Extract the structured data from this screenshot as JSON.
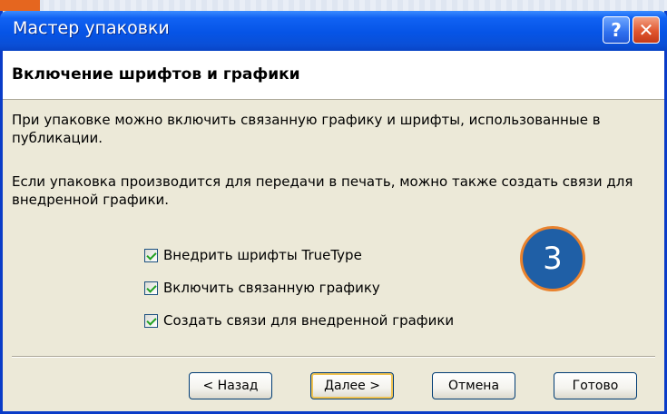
{
  "window": {
    "title": "Мастер упаковки",
    "help_glyph": "?",
    "close_glyph": "✕"
  },
  "header": {
    "title": "Включение шрифтов и графики"
  },
  "body": {
    "paragraph1": "При упаковке можно включить связанную графику и шрифты, использованные в публикации.",
    "paragraph2": "Если упаковка производится для передачи в печать, можно также создать связи для внедренной графики."
  },
  "options": [
    {
      "label": "Внедрить шрифты TrueType",
      "checked": true
    },
    {
      "label": "Включить связанную графику",
      "checked": true
    },
    {
      "label": "Создать связи для внедренной графики",
      "checked": true
    }
  ],
  "badge": {
    "text": "3"
  },
  "buttons": {
    "back": "< Назад",
    "next": "Далее >",
    "cancel": "Отмена",
    "finish": "Готово"
  },
  "colors": {
    "titlebar": "#0654e6",
    "dialog_bg": "#ece9d8",
    "badge_fill": "#1f5fa6",
    "badge_border": "#e9822d",
    "check_mark": "#21a121"
  }
}
